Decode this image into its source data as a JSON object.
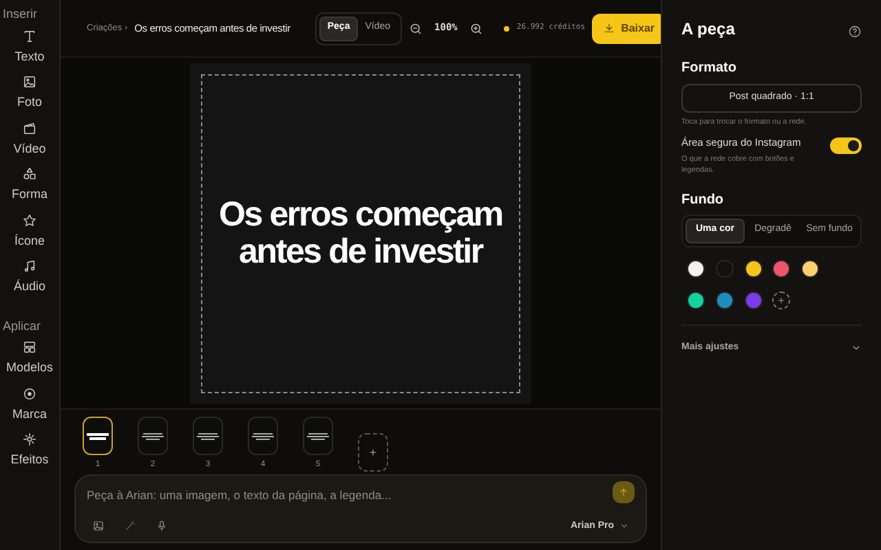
{
  "sidebar": {
    "sections": [
      {
        "title": "Inserir",
        "items": [
          {
            "label": "Texto"
          },
          {
            "label": "Foto"
          },
          {
            "label": "Vídeo"
          },
          {
            "label": "Forma"
          },
          {
            "label": "Ícone"
          },
          {
            "label": "Áudio"
          }
        ]
      },
      {
        "title": "Aplicar",
        "items": [
          {
            "label": "Modelos"
          },
          {
            "label": "Marca"
          },
          {
            "label": "Efeitos"
          }
        ]
      }
    ]
  },
  "topbar": {
    "breadcrumb": "Criações ›",
    "title": "Os erros começam antes de investir",
    "modes": [
      {
        "label": "Peça",
        "selected": true
      },
      {
        "label": "Vídeo",
        "selected": false
      }
    ],
    "zoom": "100%",
    "credits": "26.992 créditos",
    "download": "Baixar"
  },
  "canvas": {
    "headline": "Os erros começam antes de investir",
    "safe_area": true
  },
  "pages": [
    {
      "number": "1",
      "selected": true
    },
    {
      "number": "2",
      "selected": false
    },
    {
      "number": "3",
      "selected": false
    },
    {
      "number": "4",
      "selected": false
    },
    {
      "number": "5",
      "selected": false
    }
  ],
  "prompt": {
    "placeholder": "Peça à Arian: uma imagem, o texto da página, a legenda...",
    "model": "Arian Pro"
  },
  "panel": {
    "title": "A peça",
    "format_heading": "Formato",
    "format": "Post quadrado · 1:1",
    "format_hint": "Toca para trocar o formato ou a rede.",
    "safe_area_label": "Área segura do Instagram",
    "safe_area_hint": "O que a rede cobre com botões e legendas.",
    "safe_area_on": true,
    "background_heading": "Fundo",
    "background_tabs": [
      {
        "label": "Uma cor",
        "selected": true
      },
      {
        "label": "Degradê",
        "selected": false
      },
      {
        "label": "Sem fundo",
        "selected": false
      }
    ],
    "swatches": [
      {
        "color": "#f5f3ee"
      },
      {
        "color": "#111111"
      },
      {
        "color": "#f5c518"
      },
      {
        "color": "#f0546c"
      },
      {
        "color": "#fdd06e"
      },
      {
        "color": "#10d4a0"
      },
      {
        "color": "#1a8fc0"
      },
      {
        "color": "#7c3aed"
      }
    ],
    "more": "Mais ajustes"
  }
}
